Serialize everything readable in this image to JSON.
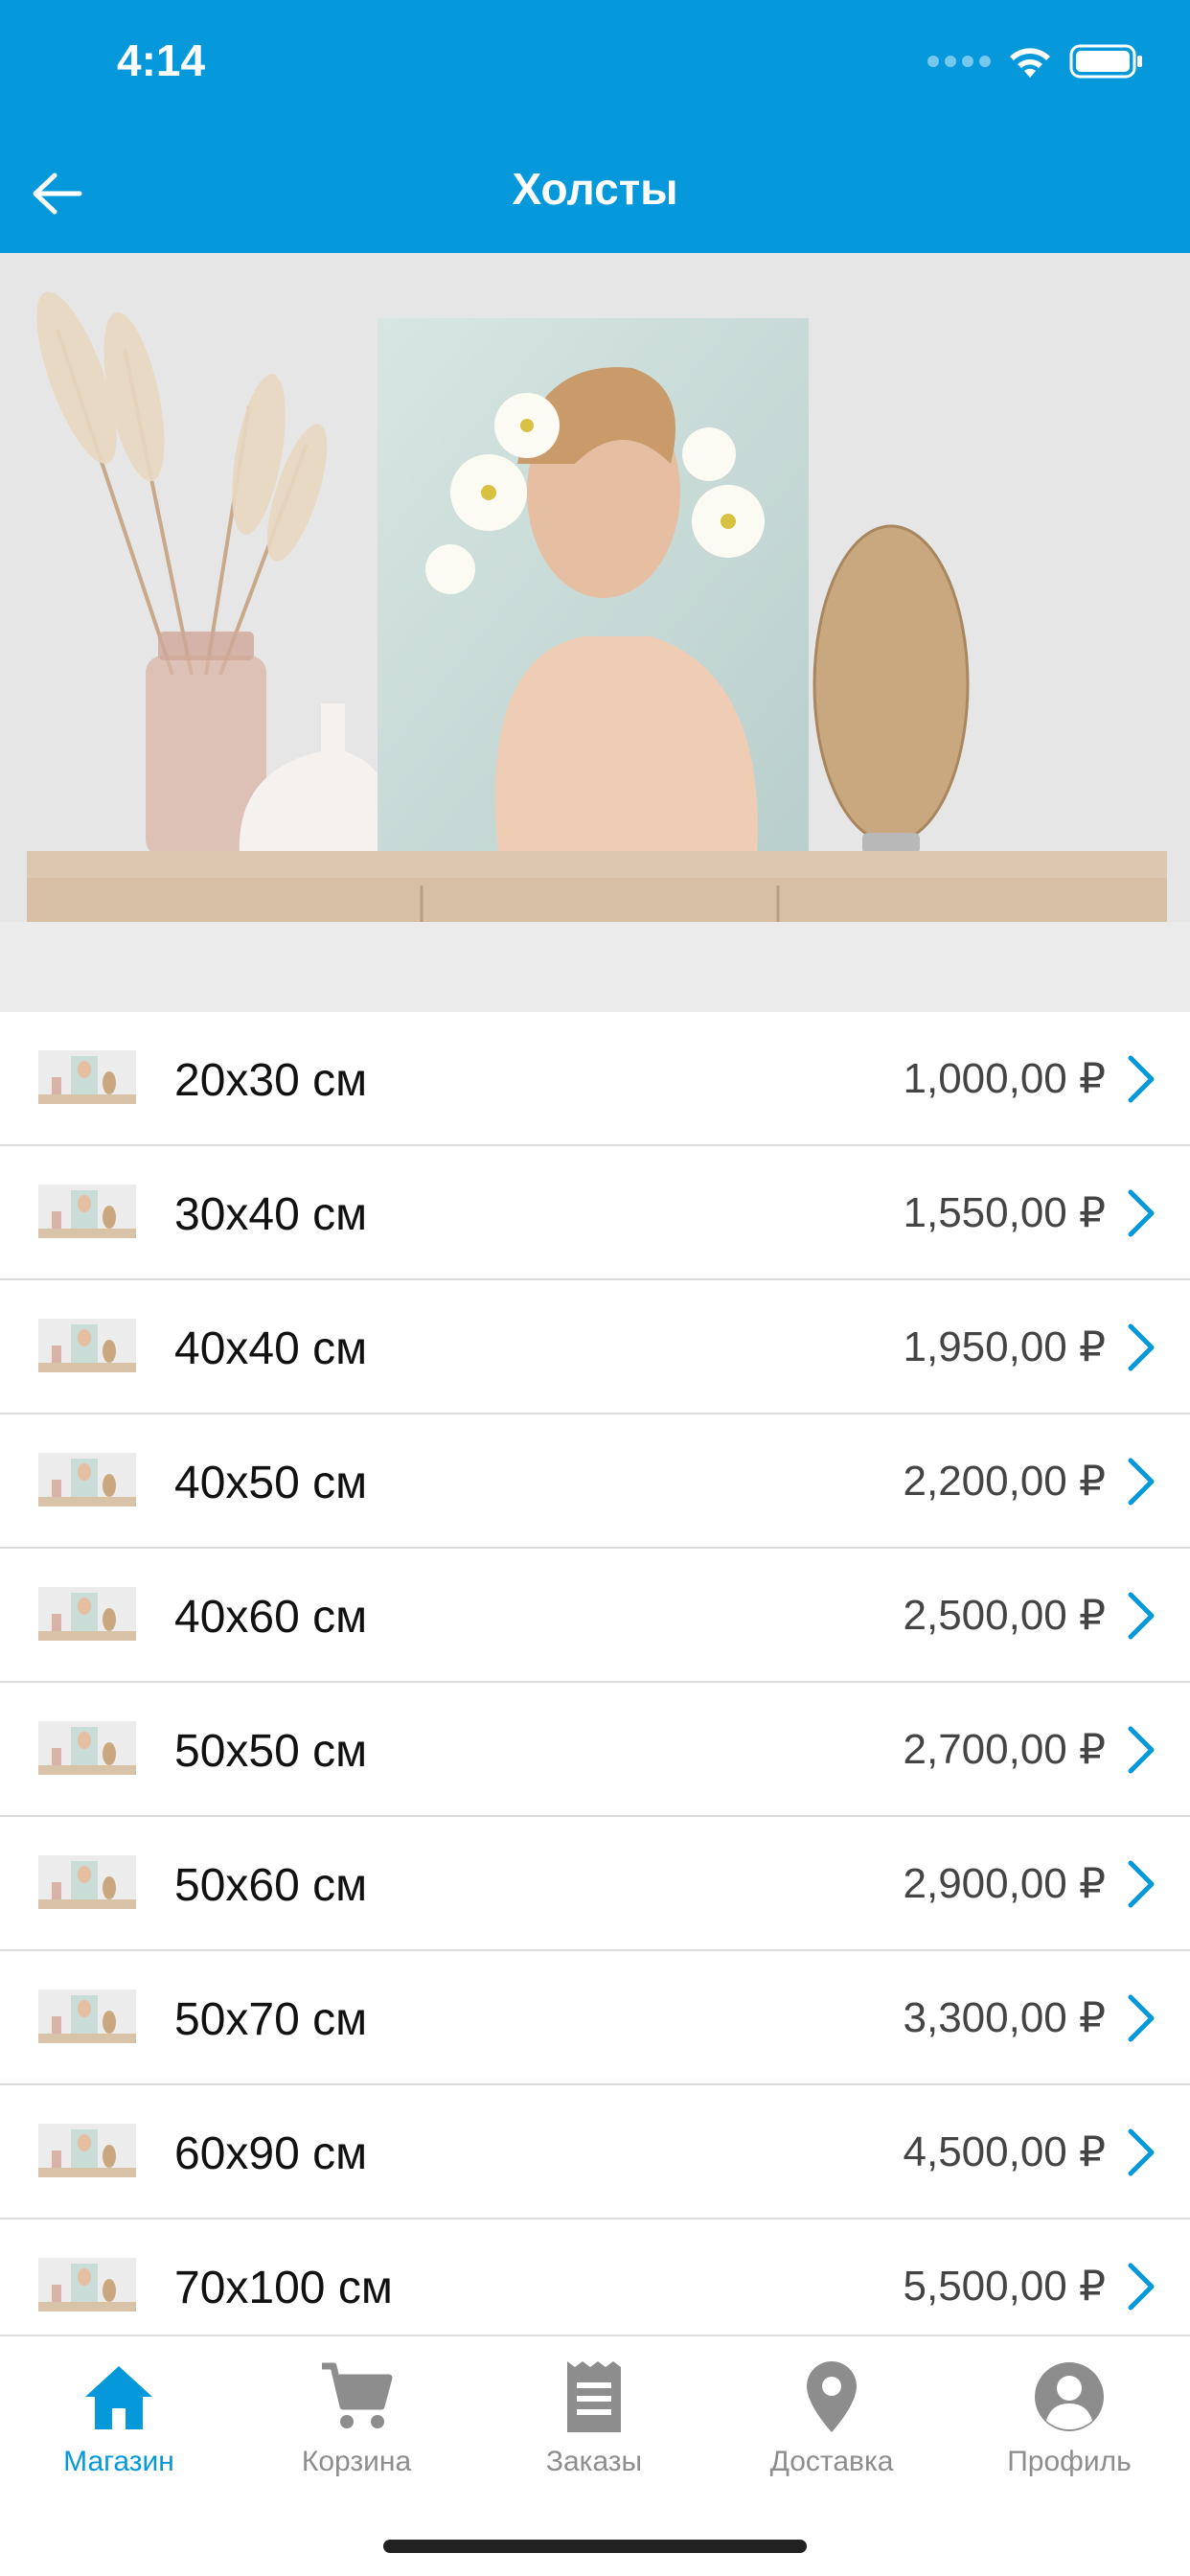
{
  "status_bar": {
    "time": "4:14"
  },
  "nav": {
    "title": "Холсты"
  },
  "list": {
    "items": [
      {
        "size": "20x30 см",
        "price": "1,000,00 ₽"
      },
      {
        "size": "30x40 см",
        "price": "1,550,00 ₽"
      },
      {
        "size": "40x40 см",
        "price": "1,950,00 ₽"
      },
      {
        "size": "40x50 см",
        "price": "2,200,00 ₽"
      },
      {
        "size": "40x60 см",
        "price": "2,500,00 ₽"
      },
      {
        "size": "50x50 см",
        "price": "2,700,00 ₽"
      },
      {
        "size": "50x60 см",
        "price": "2,900,00 ₽"
      },
      {
        "size": "50x70 см",
        "price": "3,300,00 ₽"
      },
      {
        "size": "60x90 см",
        "price": "4,500,00 ₽"
      },
      {
        "size": "70x100 см",
        "price": "5,500,00 ₽"
      }
    ]
  },
  "tabbar": {
    "tabs": [
      {
        "label": "Магазин",
        "icon": "home-icon",
        "active": true
      },
      {
        "label": "Корзина",
        "icon": "cart-icon",
        "active": false
      },
      {
        "label": "Заказы",
        "icon": "receipt-icon",
        "active": false
      },
      {
        "label": "Доставка",
        "icon": "location-pin-icon",
        "active": false
      },
      {
        "label": "Профиль",
        "icon": "profile-icon",
        "active": false
      }
    ]
  },
  "colors": {
    "primary": "#0599db",
    "inactive": "#8d8d8d",
    "background": "#ffffff"
  }
}
